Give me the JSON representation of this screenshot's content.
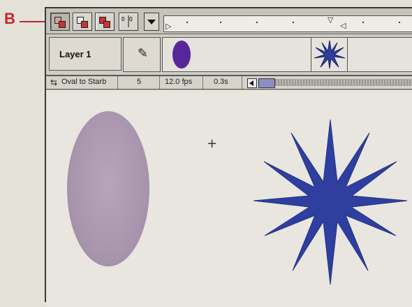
{
  "callout": {
    "label": "B"
  },
  "toolbar": {
    "buttons": [
      {
        "name": "onion-skin"
      },
      {
        "name": "onion-skin-outlines"
      },
      {
        "name": "edit-multiple-frames"
      },
      {
        "name": "modify-onion-markers"
      }
    ],
    "dropdown_icon": "chevron-down-icon"
  },
  "layer": {
    "name": "Layer 1",
    "edit_icon": "pencil-icon"
  },
  "status_bar": {
    "scene_name": "Oval to Starb",
    "current_frame": "5",
    "frame_rate": "12.0 fps",
    "elapsed_time": "0.3s"
  },
  "colors": {
    "star": "#2e3f9f",
    "oval_frame": "#57279a",
    "oval_stage": "#a995ad",
    "callout": "#c4262e"
  }
}
